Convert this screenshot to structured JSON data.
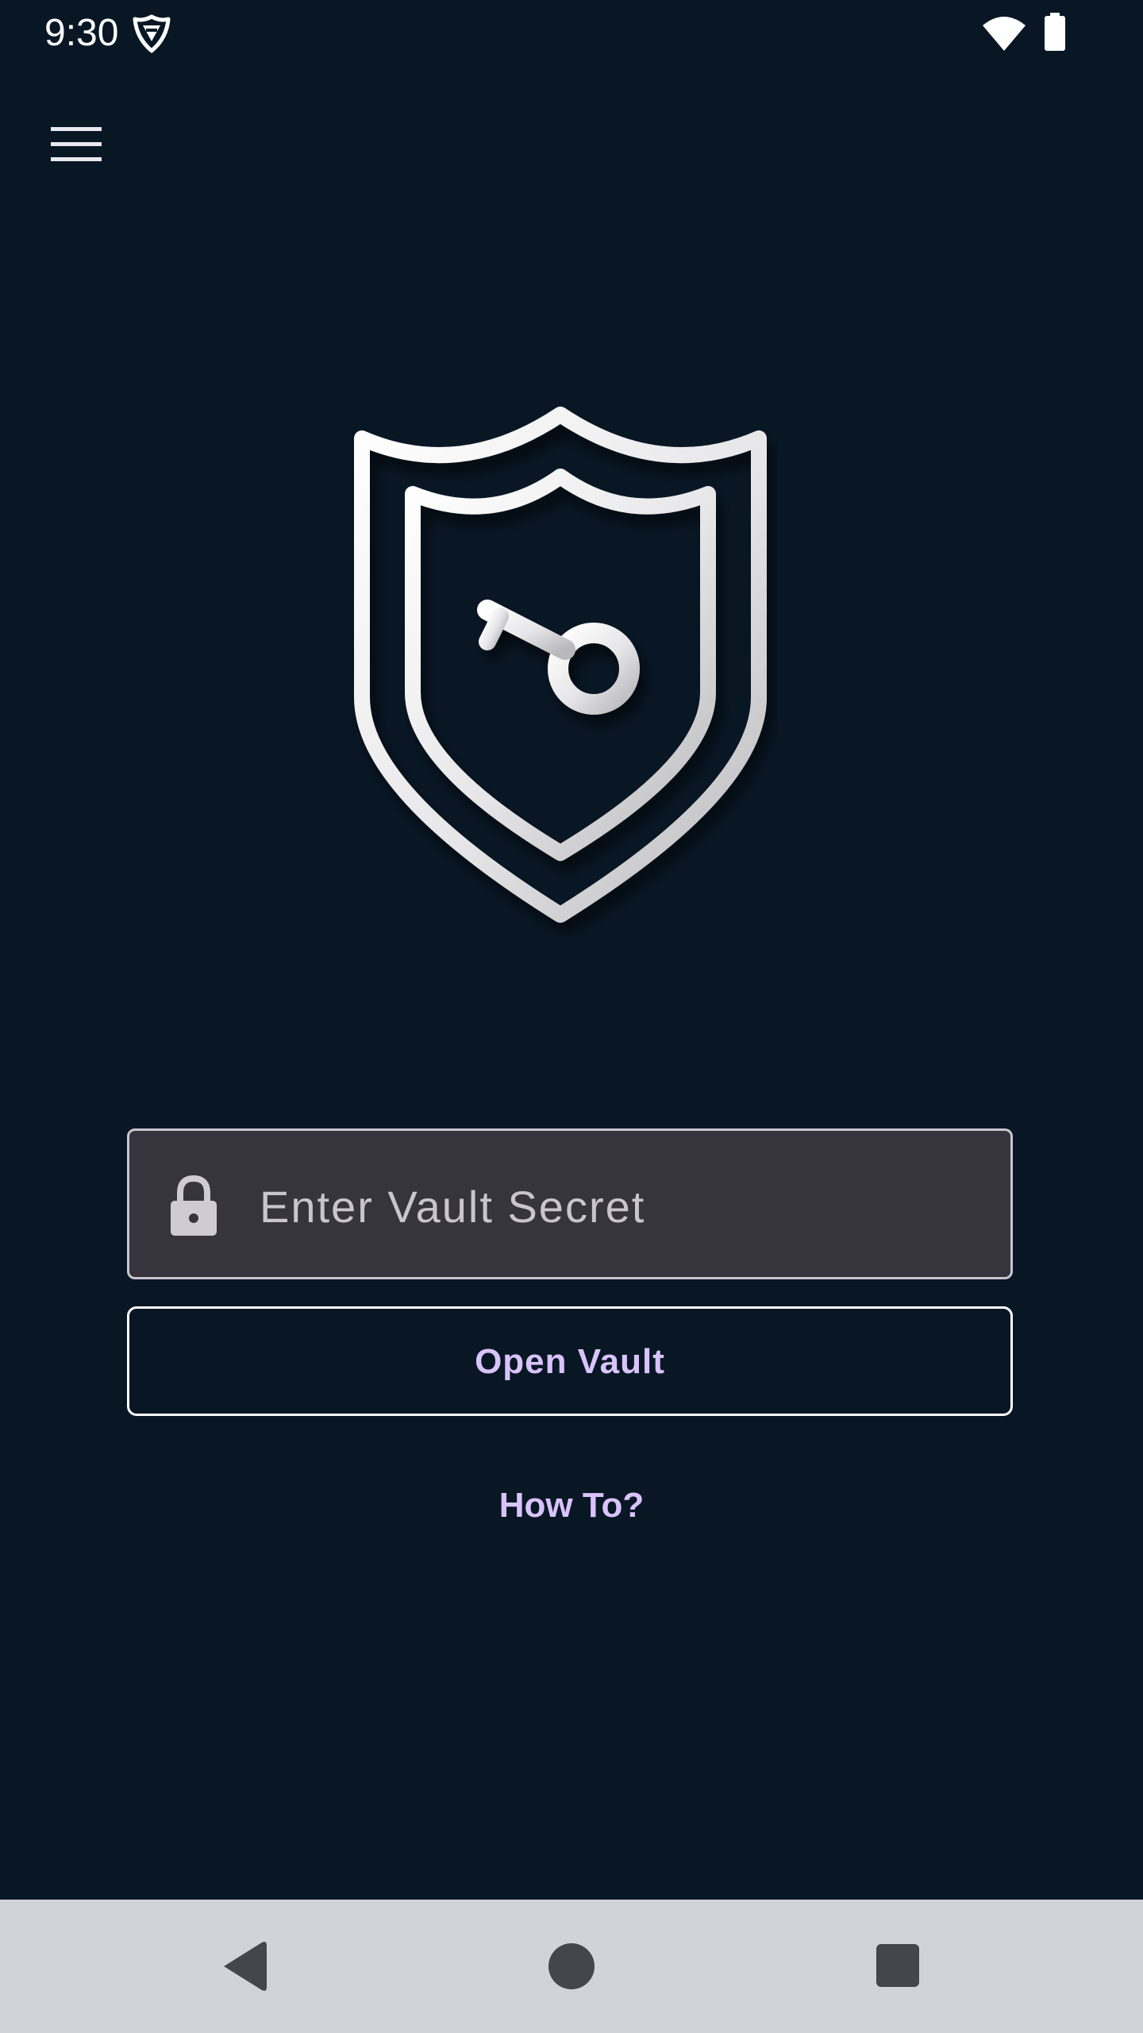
{
  "status_bar": {
    "time": "9:30",
    "icons": [
      "vpn-shield-icon",
      "wifi-icon",
      "battery-icon"
    ]
  },
  "toolbar": {
    "menu_icon": "hamburger-menu-icon"
  },
  "logo": {
    "icon": "shield-key-icon"
  },
  "secret_field": {
    "placeholder": "Enter Vault Secret",
    "value": "",
    "icon": "lock-icon"
  },
  "open_vault_button": {
    "label": "Open Vault"
  },
  "how_to_link": {
    "label": "How To?"
  },
  "nav_bar": {
    "buttons": [
      "back-icon",
      "home-icon",
      "recents-icon"
    ]
  },
  "colors": {
    "background": "#091725",
    "accent": "#d9c3fb",
    "field_background": "#36353d",
    "nav_bar": "#d0d3d7"
  }
}
